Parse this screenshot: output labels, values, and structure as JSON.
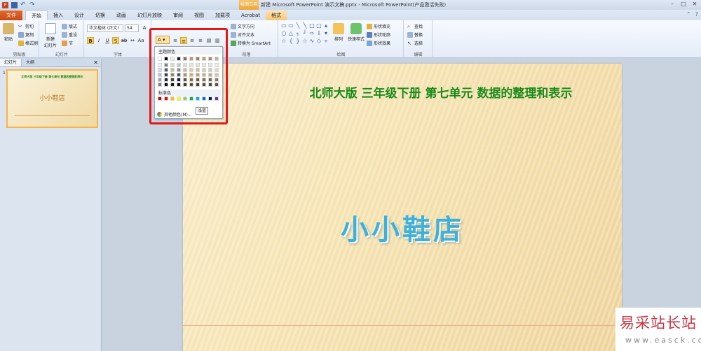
{
  "window": {
    "title": "新建 Microsoft PowerPoint 演示文稿.pptx - Microsoft PowerPoint(产品激活失败)",
    "context_tab_title": "绘图工具"
  },
  "tabs": [
    "文件",
    "开始",
    "插入",
    "设计",
    "切换",
    "动画",
    "幻灯片放映",
    "审阅",
    "视图",
    "加载项",
    "Acrobat",
    "格式"
  ],
  "ribbon": {
    "clipboard": {
      "paste": "粘贴",
      "cut": "剪切",
      "copy": "复制",
      "format_painter": "格式刷",
      "label": "剪贴板"
    },
    "slides": {
      "new_slide": "新建\n幻灯片",
      "layout": "版式",
      "reset": "重设",
      "section": "节",
      "label": "幻灯片"
    },
    "font": {
      "font_name": "华文楷体 (正文)",
      "font_size": "54",
      "label": "字体"
    },
    "paragraph": {
      "text_direction": "文字方向",
      "align_text": "对齐文本",
      "smartart": "转换为 SmartArt",
      "label": "段落"
    },
    "drawing": {
      "arrange": "排列",
      "quick_styles": "快速样式",
      "shape_fill": "形状填充",
      "shape_outline": "形状轮廓",
      "shape_effects": "形状效果",
      "label": "绘图"
    },
    "editing": {
      "find": "查找",
      "replace": "替换",
      "select": "选择",
      "label": "编辑"
    }
  },
  "panel": {
    "tab_slides": "幻灯片",
    "tab_outline": "大纲",
    "slide_number": "1"
  },
  "slide": {
    "title": "北师大版 三年级下册 第七单元 数据的整理和表示",
    "main": "小小鞋店"
  },
  "color_popup": {
    "theme_label": "主题颜色",
    "standard_label": "标准色",
    "more_colors": "其他颜色(M)...",
    "tooltip": "浅蓝",
    "theme_top": [
      "#ffffff",
      "#000000",
      "#eeece1",
      "#1f1f1f",
      "#8b6c4a",
      "#c3995e",
      "#a87a4f",
      "#c09a6b",
      "#a58a6d",
      "#c4b08a"
    ],
    "theme_shades": [
      [
        "#f2f2f2",
        "#7f7f7f",
        "#ddd9c3",
        "#c6c6c6",
        "#e7dccb",
        "#f1e3cd",
        "#ecddcb",
        "#f0e4d2",
        "#ebe3d8",
        "#f2ecdd"
      ],
      [
        "#d8d8d8",
        "#595959",
        "#c4bd97",
        "#8d8d8d",
        "#d0b995",
        "#e3c89c",
        "#d9bb97",
        "#e1caa6",
        "#d6c7b2",
        "#e5d9bb"
      ],
      [
        "#bfbfbf",
        "#3f3f3f",
        "#938953",
        "#545454",
        "#b89660",
        "#d5ad6a",
        "#c69963",
        "#d2af79",
        "#c2ab8b",
        "#d8c698"
      ],
      [
        "#a5a5a5",
        "#262626",
        "#494429",
        "#1c1c1c",
        "#67512f",
        "#94702f",
        "#7d5a34",
        "#8f6f3f",
        "#7a654d",
        "#93805a"
      ],
      [
        "#7f7f7f",
        "#0c0c0c",
        "#1d1b10",
        "#0e0e0e",
        "#453620",
        "#634b20",
        "#533c23",
        "#604a2a",
        "#514433",
        "#62553c"
      ]
    ],
    "standard": [
      "#c00000",
      "#ff0000",
      "#ffc000",
      "#ffff00",
      "#92d050",
      "#00b050",
      "#00b0f0",
      "#0070c0",
      "#002060",
      "#7030a0"
    ]
  },
  "watermark": {
    "title": "易采站长站",
    "url": "www.easck.com"
  }
}
